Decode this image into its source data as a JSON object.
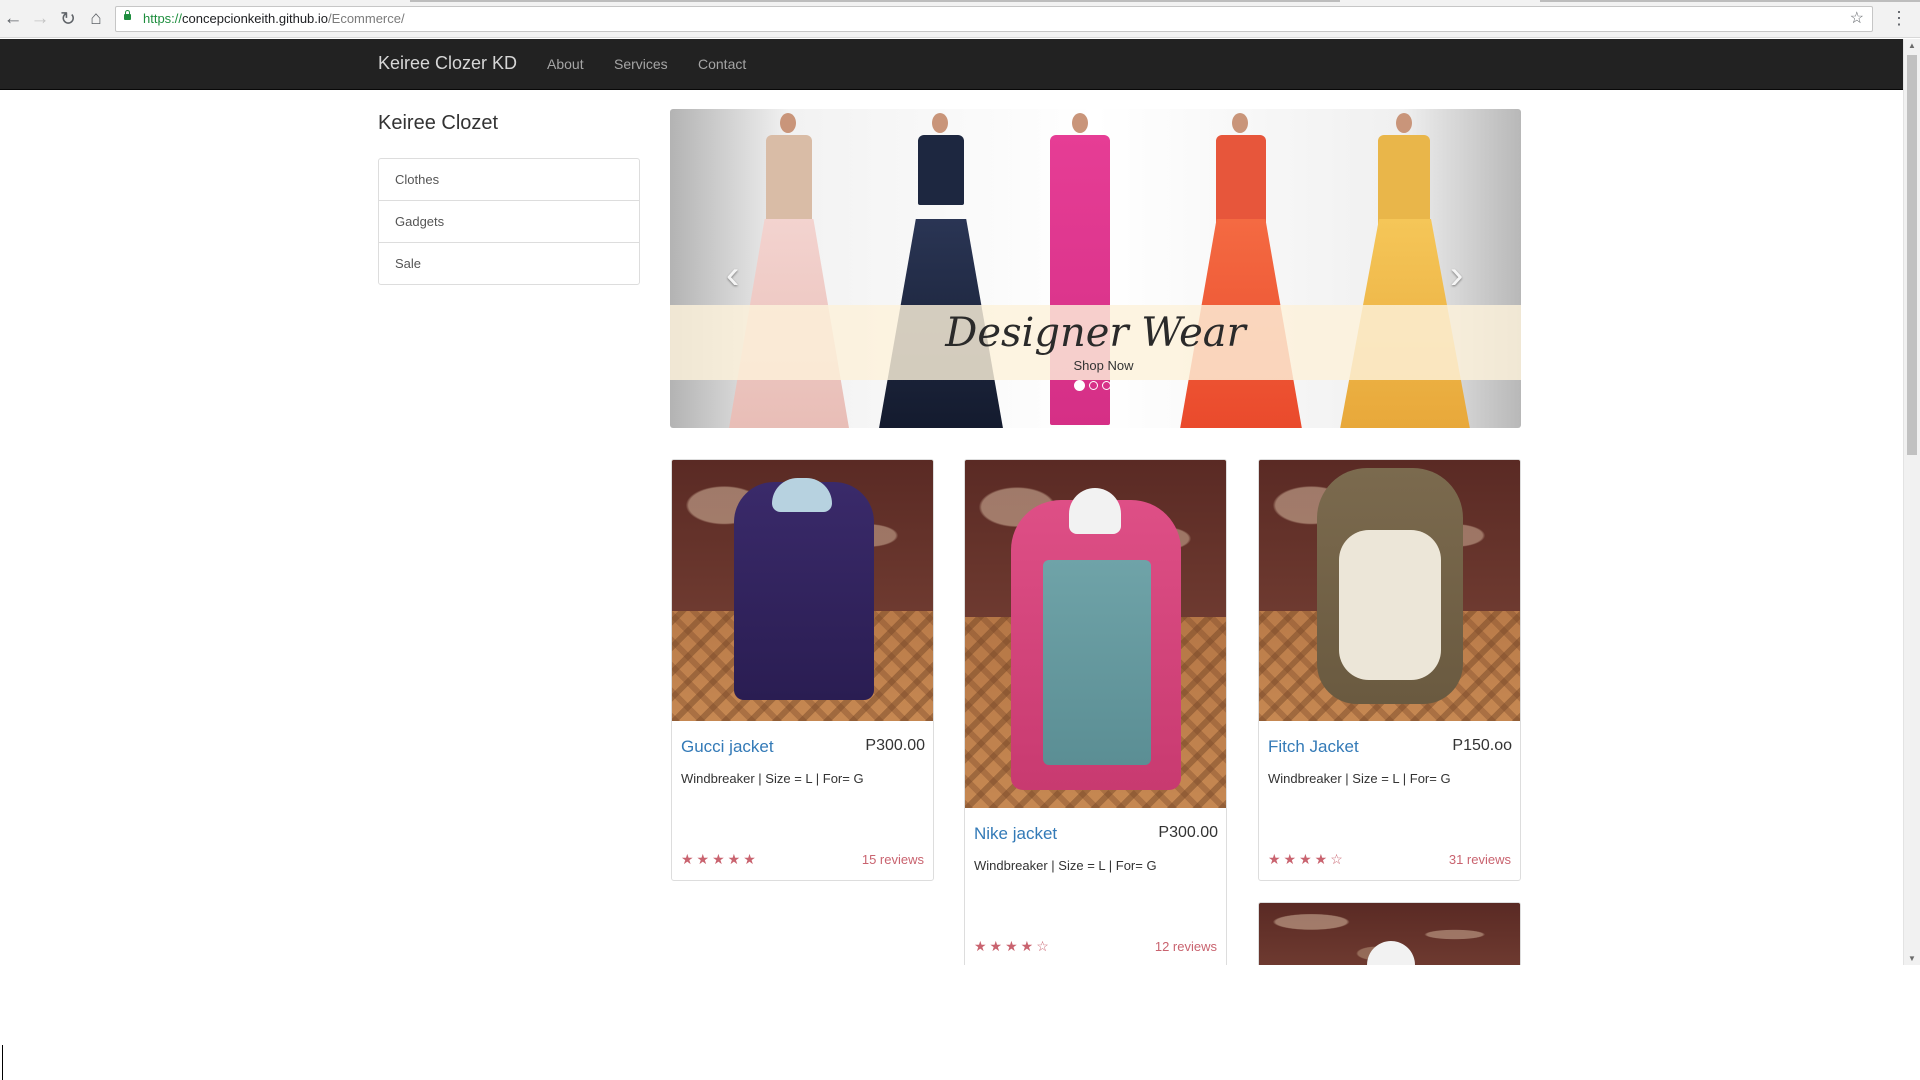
{
  "browser": {
    "url_scheme": "https://",
    "url_domain": "concepcionkeith.github.io",
    "url_path": "/Ecommerce/",
    "back_icon": "back-arrow-icon",
    "forward_icon": "forward-arrow-icon",
    "reload_icon": "reload-icon",
    "home_icon": "home-icon",
    "bookmark_icon": "star-icon",
    "menu_icon": "kebab-menu-icon"
  },
  "navbar": {
    "brand": "Keiree Clozer KD",
    "links": [
      "About",
      "Services",
      "Contact"
    ],
    "background": "#222222"
  },
  "sidebar": {
    "title": "Keiree Clozet",
    "items": [
      "Clothes",
      "Gadgets",
      "Sale"
    ]
  },
  "carousel": {
    "title": "Designer Wear",
    "subtitle": "Shop Now",
    "prev_icon": "chevron-left-icon",
    "next_icon": "chevron-right-icon",
    "slide_count": 3,
    "active_slide": 1
  },
  "products": [
    {
      "name": "Gucci jacket",
      "price": "P300.00",
      "description": "Windbreaker | Size = L | For= G",
      "rating": 5,
      "stars": "★★★★★",
      "reviews": "15 reviews"
    },
    {
      "name": "Nike jacket",
      "price": "P300.00",
      "description": "Windbreaker | Size = L | For= G",
      "rating": 4,
      "stars": "★★★★☆",
      "reviews": "12 reviews"
    },
    {
      "name": "Fitch Jacket",
      "price": "P150.oo",
      "description": "Windbreaker | Size = L | For= G",
      "rating": 4,
      "stars": "★★★★☆",
      "reviews": "31 reviews"
    }
  ],
  "colors": {
    "link": "#337ab7",
    "rating": "#c9636f",
    "secure": "#1e8e3e"
  }
}
